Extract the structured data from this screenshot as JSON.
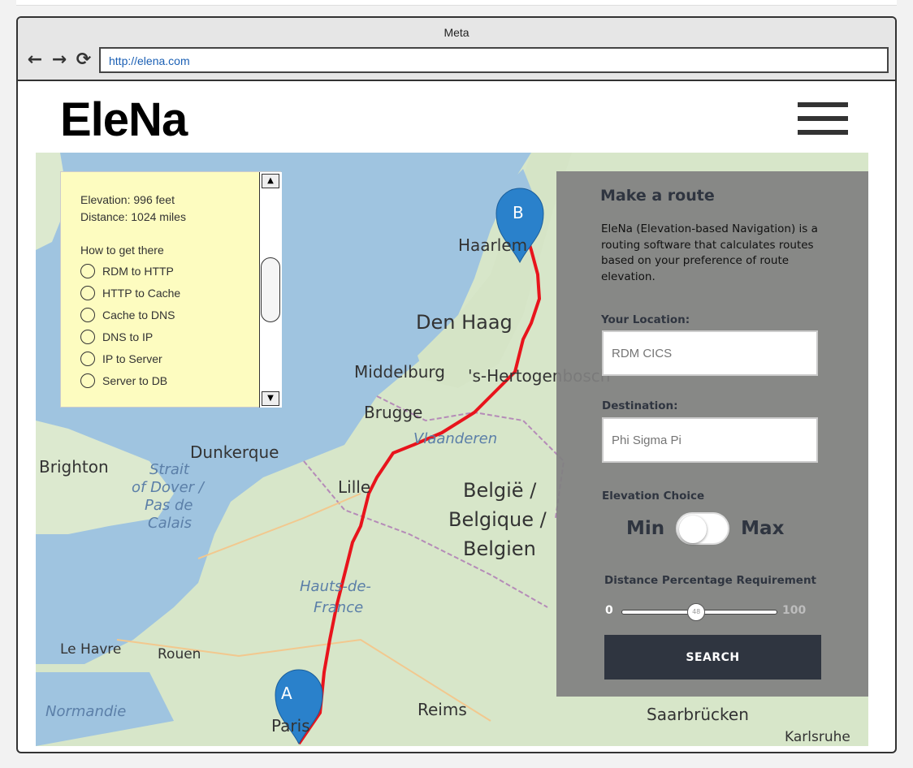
{
  "window": {
    "title": "Meta"
  },
  "browser": {
    "url": "http://elena.com",
    "back_icon": "arrow-left-icon",
    "forward_icon": "arrow-right-icon",
    "reload_icon": "reload-icon"
  },
  "app": {
    "logo": "EleNa",
    "menu_icon": "hamburger-icon"
  },
  "map": {
    "markers": {
      "start": "A",
      "end": "B"
    },
    "route_color": "#e8141c",
    "labels": [
      "Haarlem",
      "Den Haag",
      "Middelburg",
      "'s-Hertogenbosch",
      "Brugge",
      "Dunkerque",
      "Brighton",
      "Strait",
      "of Dover /",
      "Pas de",
      "Calais",
      "Lille",
      "Vlaanderen",
      "België /",
      "Belgique /",
      "Belgien",
      "Hauts-de-",
      "France",
      "Le Havre",
      "Rouen",
      "Normandie",
      "Paris",
      "Reims",
      "Saarbrücken",
      "Karlsruhe"
    ]
  },
  "info_box": {
    "elevation": "Elevation: 996 feet",
    "distance": "Distance: 1024 miles",
    "steps_title": "How to get there",
    "steps": [
      "RDM to HTTP",
      "HTTP to Cache",
      "Cache to DNS",
      "DNS to IP",
      "IP to Server",
      "Server to DB"
    ]
  },
  "route_panel": {
    "title": "Make a route",
    "description": "EleNa (Elevation-based Navigation) is a routing software that calculates routes based on your preference of route elevation.",
    "location_label": "Your Location:",
    "location_placeholder": "RDM CICS",
    "destination_label": "Destination:",
    "destination_placeholder": "Phi Sigma Pi",
    "elevation_label": "Elevation Choice",
    "toggle_min": "Min",
    "toggle_max": "Max",
    "distance_label": "Distance Percentage Requirement",
    "slider_min": "0",
    "slider_max": "100",
    "slider_value": "48",
    "search_label": "SEARCH"
  }
}
